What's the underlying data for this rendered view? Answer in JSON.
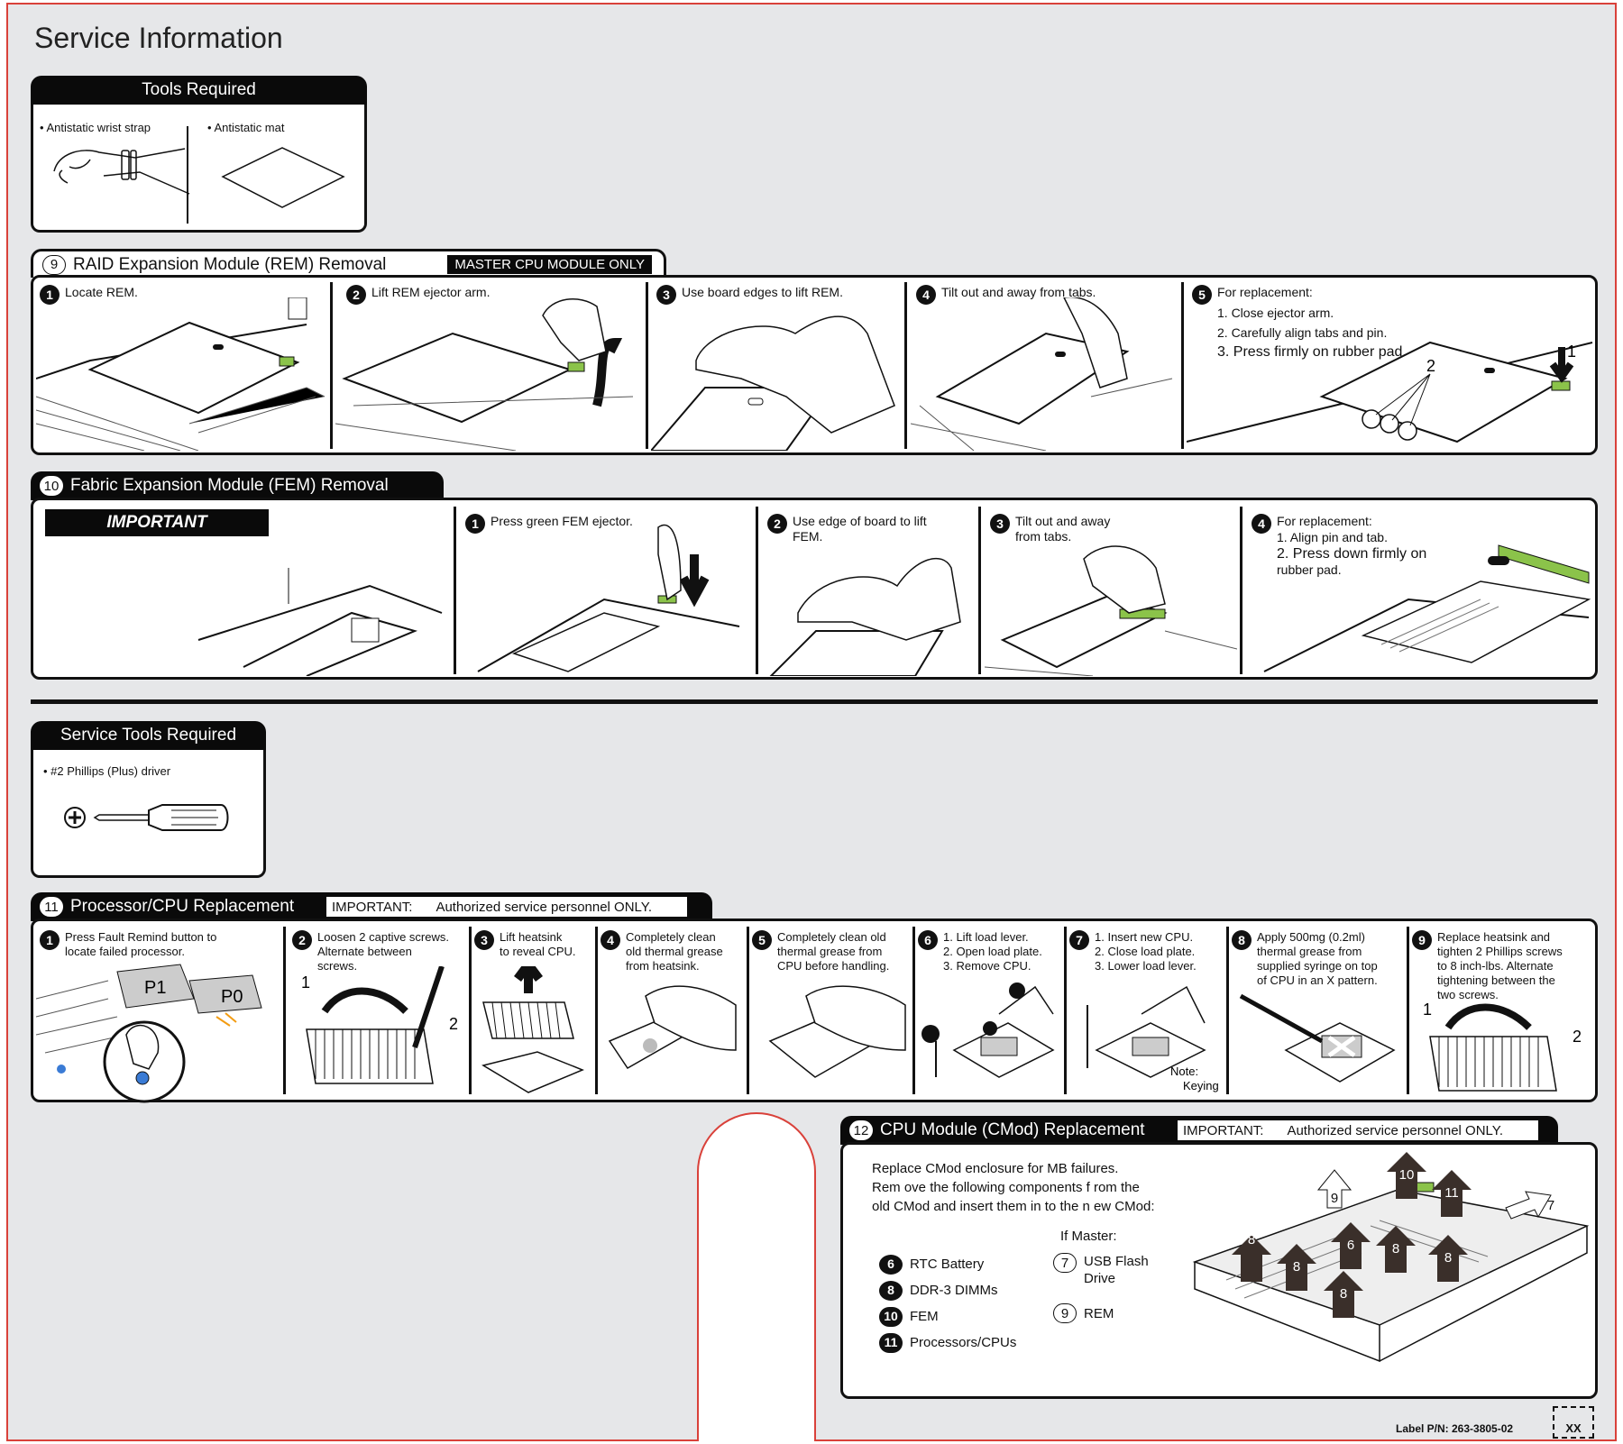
{
  "page_title": "Service Information",
  "tools": {
    "title": "Tools Required",
    "items": [
      "• Antistatic wrist strap",
      "• Antistatic mat"
    ]
  },
  "rem": {
    "num": "9",
    "title": "RAID Expansion Module (REM) Removal",
    "badge": "MASTER CPU MODULE ONLY",
    "steps": [
      {
        "num": "1",
        "text": "Locate REM."
      },
      {
        "num": "2",
        "text": "Lift REM ejector arm."
      },
      {
        "num": "3",
        "text": "Use board edges to lift REM."
      },
      {
        "num": "4",
        "text": "Tilt out and away from tabs."
      },
      {
        "num": "5",
        "text": "For replacement:",
        "lines": [
          "1. Close ejector arm.",
          "2. Carefully align tabs and pin.",
          "3. Press firmly on rubber pad."
        ]
      }
    ],
    "callouts": [
      "2",
      "1"
    ]
  },
  "fem": {
    "num": "10",
    "title": "Fabric Expansion Module (FEM) Removal",
    "important": "IMPORTANT",
    "steps": [
      {
        "num": "1",
        "text": "Press green FEM ejector."
      },
      {
        "num": "2",
        "text": "Use edge of board to lift FEM."
      },
      {
        "num": "3",
        "text": "Tilt out and away from tabs."
      },
      {
        "num": "4",
        "text": "For replacement:",
        "lines": [
          "1. Align pin and tab.",
          "2. Press down firmly on",
          "rubber pad."
        ]
      }
    ]
  },
  "service_tools": {
    "title": "Service Tools Required",
    "item": "• #2 Phillips (Plus) driver"
  },
  "cpu": {
    "num": "11",
    "title": "Processor/CPU Replacement",
    "important_label": "IMPORTANT:",
    "important_text": "Authorized service personnel ONLY.",
    "steps": [
      {
        "num": "1",
        "lines": [
          "Press Fault Remind button to",
          "locate failed processor."
        ]
      },
      {
        "num": "2",
        "lines": [
          "Loosen 2 captive screws.",
          "Alternate between",
          "screws."
        ]
      },
      {
        "num": "3",
        "lines": [
          "Lift heatsink",
          "to reveal CPU."
        ]
      },
      {
        "num": "4",
        "lines": [
          "Completely clean",
          "old thermal grease",
          "from heatsink."
        ]
      },
      {
        "num": "5",
        "lines": [
          "Completely clean old",
          "thermal grease from",
          "CPU before handling."
        ]
      },
      {
        "num": "6",
        "lines": [
          "1. Lift load lever.",
          "2. Open load plate.",
          "3. Remove CPU."
        ]
      },
      {
        "num": "7",
        "lines": [
          "1. Insert new CPU.",
          "2. Close load plate.",
          "3. Lower load lever."
        ]
      },
      {
        "num": "8",
        "lines": [
          "Apply 500mg (0.2ml)",
          "thermal grease from",
          "supplied syringe on top",
          "of CPU in an X pattern."
        ]
      },
      {
        "num": "9",
        "lines": [
          "Replace heatsink and",
          "tighten 2 Phillips screws",
          "to 8 inch-lbs. Alternate",
          "tightening between the",
          "two screws."
        ]
      }
    ],
    "labels": {
      "p1": "P1",
      "p0": "P0",
      "note": "Note:",
      "keying": "Keying"
    }
  },
  "cmod": {
    "num": "12",
    "title": "CPU Module (CMod) Replacement",
    "important_label": "IMPORTANT:",
    "important_text": "Authorized service personnel ONLY.",
    "intro": [
      "Replace CMod enclosure for MB failures.",
      "Rem ove  the following components f      rom the",
      "old CMod and insert them in        to the n  ew CMod:"
    ],
    "if_master": "If Master:",
    "components": [
      {
        "num": "6",
        "label": "RTC Battery"
      },
      {
        "num": "8",
        "label": "DDR-3 DIMMs"
      },
      {
        "num": "10",
        "label": "FEM"
      },
      {
        "num": "11",
        "label": "Processors/CPUs"
      }
    ],
    "master_components": [
      {
        "num": "7",
        "label": "USB Flash",
        "label2": "Drive"
      },
      {
        "num": "9",
        "label": "REM"
      }
    ],
    "arrow_labels": [
      "8",
      "8",
      "8",
      "8",
      "8",
      "6",
      "9",
      "10",
      "11",
      "7"
    ]
  },
  "footer": {
    "label_pn": "Label P/N: 263-3805-02",
    "code": "XX"
  }
}
